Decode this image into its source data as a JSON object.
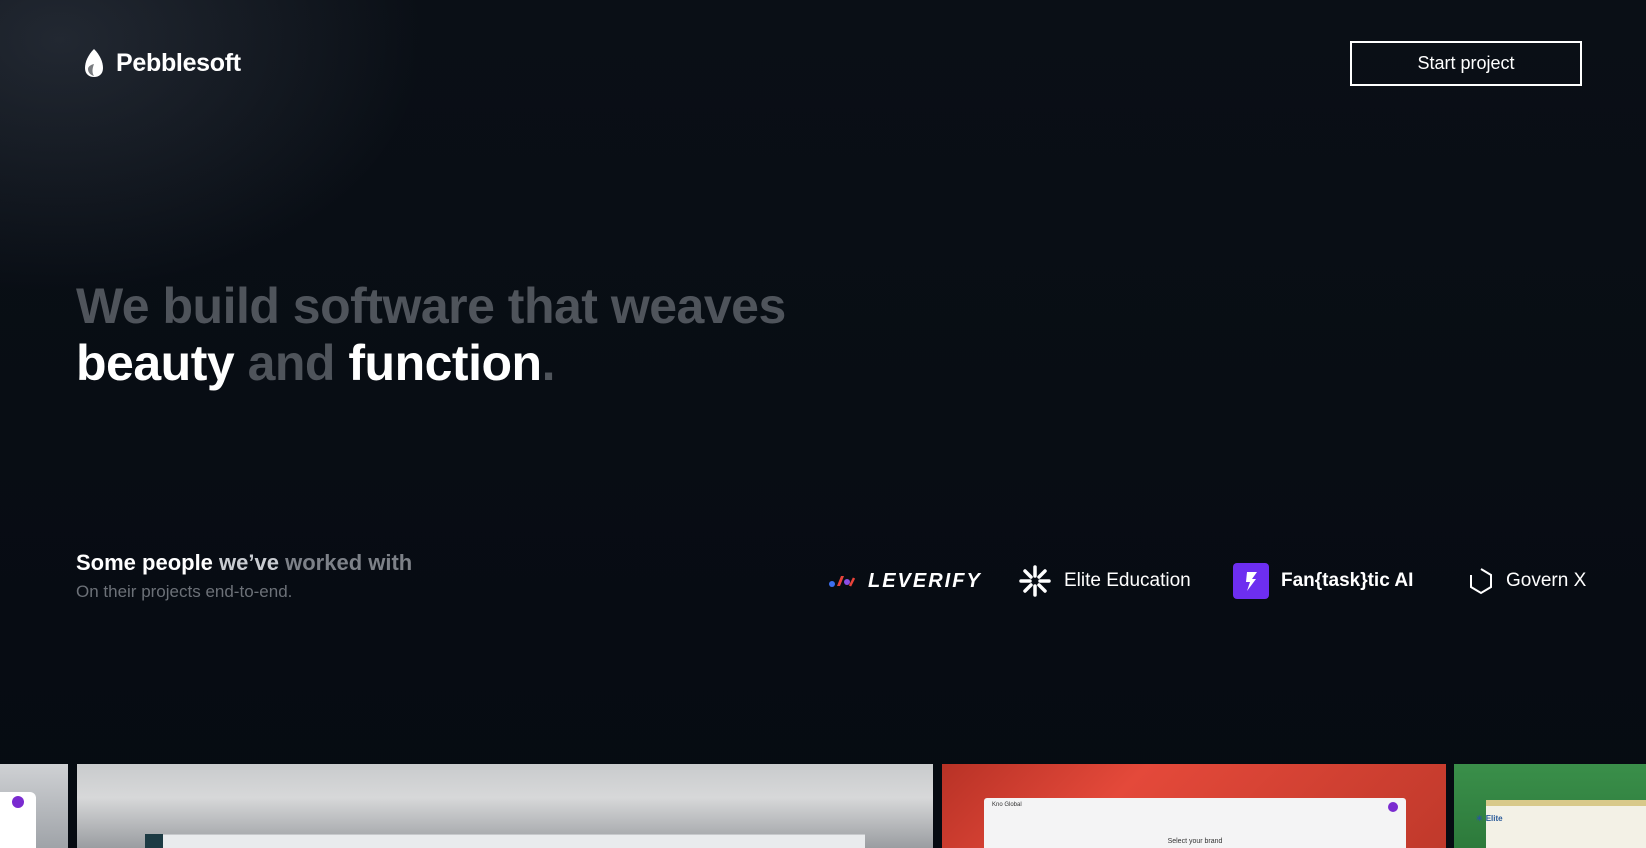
{
  "header": {
    "brand": "Pebblesoft",
    "cta_label": "Start project"
  },
  "hero": {
    "line1": "We build software that weaves",
    "word_beauty": "beauty",
    "word_and": "and",
    "word_function": "function",
    "period": "."
  },
  "clients": {
    "title_part1": "Some people",
    "title_part2": "we’ve",
    "title_part3": "worked with",
    "subtitle": "On their projects end-to-end.",
    "logos": [
      {
        "name": "LEVERIFY",
        "icon": "leverify-logo-icon"
      },
      {
        "name": "Elite Education",
        "icon": "starburst-icon"
      },
      {
        "name": "Fan{task}tic AI",
        "icon": "lightning-icon"
      },
      {
        "name": "Govern X",
        "icon": "hexagon-icon"
      }
    ]
  },
  "showcase": {
    "kno_title": "Kno Global",
    "kno_label": "Select your brand",
    "elite_label": "Elite"
  },
  "colors": {
    "background": "#060b12",
    "muted_text": "#4f545b",
    "fantask_purple": "#6d2ef0"
  }
}
